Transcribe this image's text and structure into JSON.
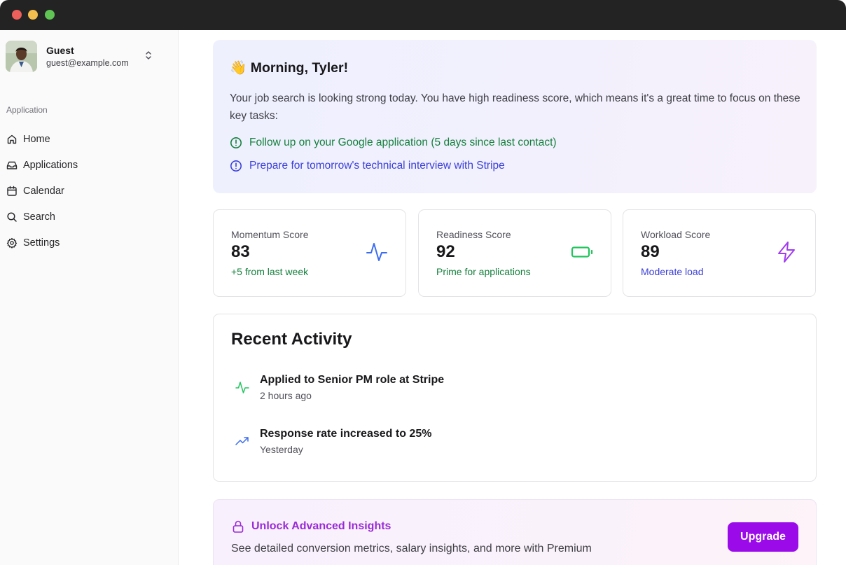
{
  "user": {
    "name": "Guest",
    "email": "guest@example.com"
  },
  "sidebar": {
    "section_label": "Application",
    "items": [
      {
        "label": "Home",
        "icon": "home-icon"
      },
      {
        "label": "Applications",
        "icon": "inbox-icon"
      },
      {
        "label": "Calendar",
        "icon": "calendar-icon"
      },
      {
        "label": "Search",
        "icon": "search-icon"
      },
      {
        "label": "Settings",
        "icon": "gear-icon"
      }
    ]
  },
  "welcome": {
    "emoji": "👋",
    "greeting": "Morning, Tyler!",
    "body": "Your job search is looking strong today. You have high readiness score, which means it's a great time to focus on these key tasks:",
    "tasks": [
      {
        "text": "Follow up on your Google application (5 days since last contact)",
        "color": "#15803d",
        "icon": "alert-circle-icon"
      },
      {
        "text": "Prepare for tomorrow's technical interview with Stripe",
        "color": "#3b3fd8",
        "icon": "alert-circle-icon"
      }
    ]
  },
  "scores": [
    {
      "label": "Momentum Score",
      "value": "83",
      "sub": "+5 from last week",
      "sub_color": "#15803d",
      "icon": "activity-icon",
      "icon_color": "#3b6cf0"
    },
    {
      "label": "Readiness Score",
      "value": "92",
      "sub": "Prime for applications",
      "sub_color": "#15803d",
      "icon": "battery-icon",
      "icon_color": "#22c55e"
    },
    {
      "label": "Workload Score",
      "value": "89",
      "sub": "Moderate load",
      "sub_color": "#3b3fd8",
      "icon": "zap-icon",
      "icon_color": "#a03cf0"
    }
  ],
  "activity": {
    "title": "Recent Activity",
    "items": [
      {
        "text": "Applied to Senior PM role at Stripe",
        "time": "2 hours ago",
        "icon": "activity-icon",
        "icon_color": "#22c55e"
      },
      {
        "text": "Response rate increased to 25%",
        "time": "Yesterday",
        "icon": "trending-up-icon",
        "icon_color": "#3b6cf0"
      }
    ]
  },
  "upsell": {
    "title": "Unlock Advanced Insights",
    "body": "See detailed conversion metrics, salary insights, and more with Premium",
    "button": "Upgrade",
    "accent": "#9b0bea"
  }
}
